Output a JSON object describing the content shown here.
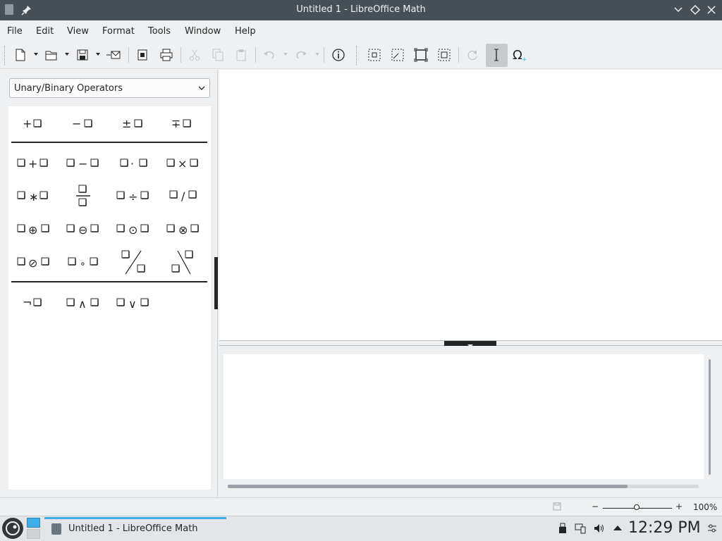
{
  "window": {
    "title": "Untitled 1 - LibreOffice Math"
  },
  "menu": {
    "items": [
      "File",
      "Edit",
      "View",
      "Format",
      "Tools",
      "Window",
      "Help"
    ]
  },
  "toolbar": {
    "buttons": [
      "new-document",
      "open",
      "save",
      "export-pdf-email",
      "export-pdf",
      "print",
      "cut",
      "copy",
      "paste",
      "undo",
      "redo",
      "insert-info",
      "zoom-in",
      "zoom-out",
      "show-all",
      "fit-to-window",
      "update",
      "formula-cursor",
      "symbols"
    ],
    "active": "formula-cursor"
  },
  "elements_panel": {
    "category": "Unary/Binary Operators",
    "rows": [
      [
        "+□",
        "−□",
        "±□",
        "∓□"
      ],
      [
        "□+□",
        "□−□",
        "□·□",
        "□×□"
      ],
      [
        "□∗□",
        "□/□ fraction",
        "□÷□",
        "□/□"
      ],
      [
        "□⊕□",
        "□⊖□",
        "□⊙□",
        "□⊗□"
      ],
      [
        "□⊘□",
        "□∘□",
        "wideslash",
        "widebslash"
      ],
      [
        "¬□",
        "□∧□",
        "□∨□"
      ]
    ]
  },
  "statusbar": {
    "zoom_minus": "−",
    "zoom_plus": "+",
    "zoom": "100%",
    "zoom_level": 1.0
  },
  "taskbar": {
    "task_label": "Untitled 1 - LibreOffice Math",
    "clock": "12:29 PM"
  },
  "colors": {
    "titlebar": "#475057",
    "accent": "#3daee9",
    "panel": "#eff0f1"
  }
}
